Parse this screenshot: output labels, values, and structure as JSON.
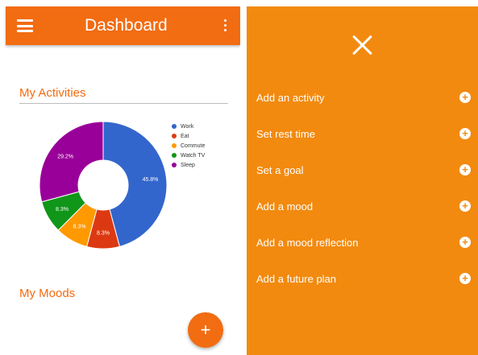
{
  "appbar": {
    "title": "Dashboard"
  },
  "activities": {
    "title": "My Activities"
  },
  "moods": {
    "title": "My Moods"
  },
  "fab": {
    "label": "+"
  },
  "chart_data": {
    "type": "pie",
    "title": "",
    "series": [
      {
        "name": "Work",
        "value": 45.8,
        "label": "45.8%",
        "color": "#3366cc"
      },
      {
        "name": "Eat",
        "value": 8.3,
        "label": "8.3%",
        "color": "#dc3912"
      },
      {
        "name": "Commute",
        "value": 8.3,
        "label": "8.3%",
        "color": "#ff9900"
      },
      {
        "name": "Watch TV",
        "value": 8.3,
        "label": "8.3%",
        "color": "#109618"
      },
      {
        "name": "Sleep",
        "value": 29.2,
        "label": "29.2%",
        "color": "#990099"
      }
    ],
    "donut": true,
    "legend": "right"
  },
  "drawer": {
    "items": [
      {
        "label": "Add an activity",
        "icon": "plus-circle-icon"
      },
      {
        "label": "Set rest time",
        "icon": "plus-circle-icon"
      },
      {
        "label": "Set a goal",
        "icon": "plus-circle-icon"
      },
      {
        "label": "Add a mood",
        "icon": "plus-circle-icon"
      },
      {
        "label": "Add a mood reflection",
        "icon": "plus-circle-icon"
      },
      {
        "label": "Add a future plan",
        "icon": "plus-circle-icon"
      }
    ]
  },
  "colors": {
    "primary": "#f26c12",
    "drawer": "#f28a0f"
  }
}
